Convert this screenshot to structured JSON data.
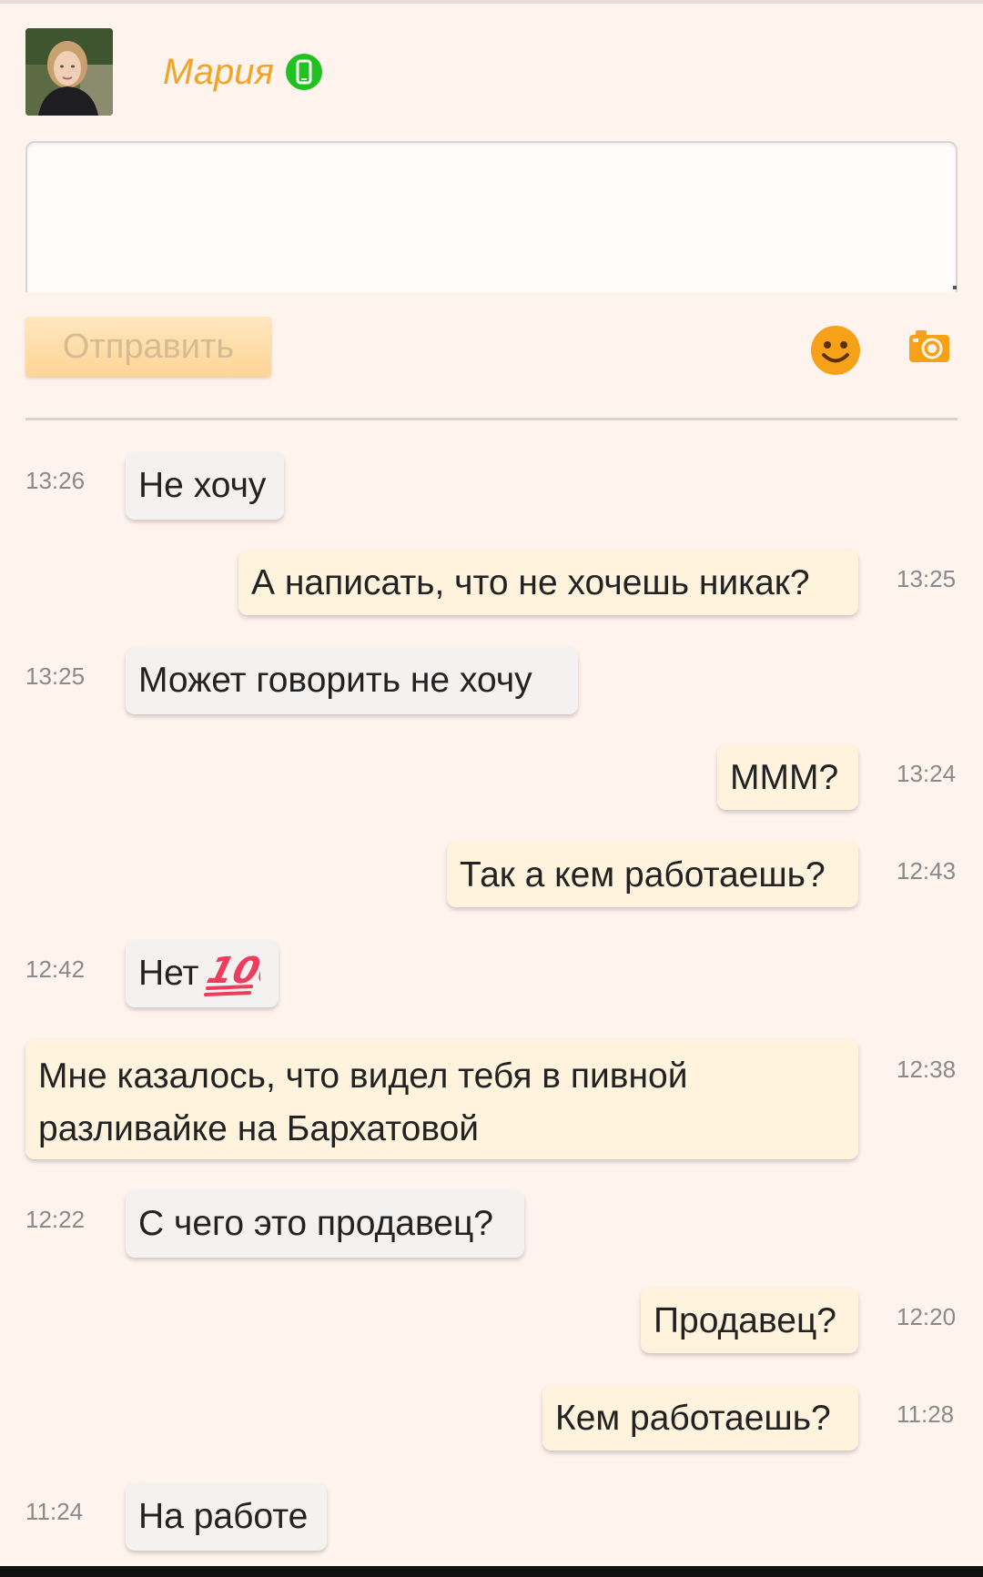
{
  "contact": {
    "name": "Мария",
    "status_icon": "mobile-online-icon"
  },
  "composer": {
    "input_value": "",
    "send_label": "Отправить",
    "emoji_icon": "smile-icon",
    "photo_icon": "camera-icon"
  },
  "colors": {
    "background": "#fff3ee",
    "name": "#f0a52a",
    "incoming_bubble": "#f4f2f1",
    "outgoing_bubble": "#fff3dd",
    "online": "#22c122",
    "accent": "#f6a118"
  },
  "messages": [
    {
      "direction": "in",
      "time": "13:26",
      "text": "Не хочу"
    },
    {
      "direction": "out",
      "time": "13:25",
      "text": "А написать, что не хочешь никак?"
    },
    {
      "direction": "in",
      "time": "13:25",
      "text": "Может говорить не хочу"
    },
    {
      "direction": "out",
      "time": "13:24",
      "text": "МММ?"
    },
    {
      "direction": "out",
      "time": "12:43",
      "text": "Так а кем работаешь?"
    },
    {
      "direction": "in",
      "time": "12:42",
      "text": "Нет",
      "emoji": "hundred-points-emoji"
    },
    {
      "direction": "out",
      "time": "12:38",
      "text": "Мне казалось, что видел тебя в пивной разливайке на Бархатовой"
    },
    {
      "direction": "in",
      "time": "12:22",
      "text": "С чего это продавец?"
    },
    {
      "direction": "out",
      "time": "12:20",
      "text": "Продавец?"
    },
    {
      "direction": "out",
      "time": "11:28",
      "text": "Кем работаешь?"
    },
    {
      "direction": "in",
      "time": "11:24",
      "text": "На работе"
    }
  ]
}
